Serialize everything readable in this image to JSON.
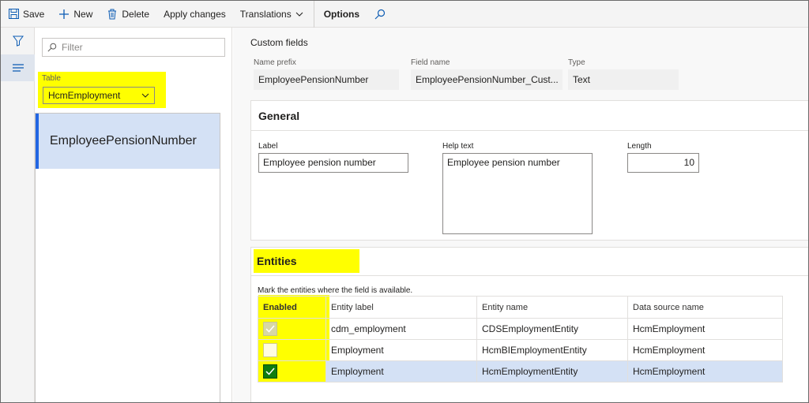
{
  "toolbar": {
    "save_label": "Save",
    "new_label": "New",
    "delete_label": "Delete",
    "apply_label": "Apply changes",
    "translations_label": "Translations",
    "options_label": "Options"
  },
  "list_pane": {
    "filter_placeholder": "Filter",
    "table_label": "Table",
    "table_value": "HcmEmployment",
    "items": [
      {
        "label": "EmployeePensionNumber"
      }
    ]
  },
  "custom_fields": {
    "title": "Custom fields",
    "name_prefix_label": "Name prefix",
    "name_prefix_value": "EmployeePensionNumber",
    "field_name_label": "Field name",
    "field_name_value": "EmployeePensionNumber_Cust...",
    "type_label": "Type",
    "type_value": "Text"
  },
  "general": {
    "heading": "General",
    "label_label": "Label",
    "label_value": "Employee pension number",
    "help_label": "Help text",
    "help_value": "Employee pension number",
    "length_label": "Length",
    "length_value": "10"
  },
  "entities": {
    "heading": "Entities",
    "instruction": "Mark the entities where the field is available.",
    "columns": [
      "Enabled",
      "Entity label",
      "Entity name",
      "Data source name"
    ],
    "rows": [
      {
        "enabled": "disabled-checked",
        "label": "cdm_employment",
        "name": "CDSEmploymentEntity",
        "source": "HcmEmployment"
      },
      {
        "enabled": "unchecked",
        "label": "Employment",
        "name": "HcmBIEmploymentEntity",
        "source": "HcmEmployment"
      },
      {
        "enabled": "checked",
        "label": "Employment",
        "name": "HcmEmploymentEntity",
        "source": "HcmEmployment"
      }
    ]
  },
  "icons": {
    "save": "save-icon",
    "new": "plus-icon",
    "delete": "trash-icon",
    "translations": "chevron-down-icon",
    "search": "search-icon",
    "filter_rail": "funnel-icon",
    "list_rail": "list-icon"
  },
  "colors": {
    "accent": "#0b5bb3",
    "highlight": "#ffff00",
    "selected_row": "#d4e1f5",
    "checkbox_on": "#107c10"
  }
}
